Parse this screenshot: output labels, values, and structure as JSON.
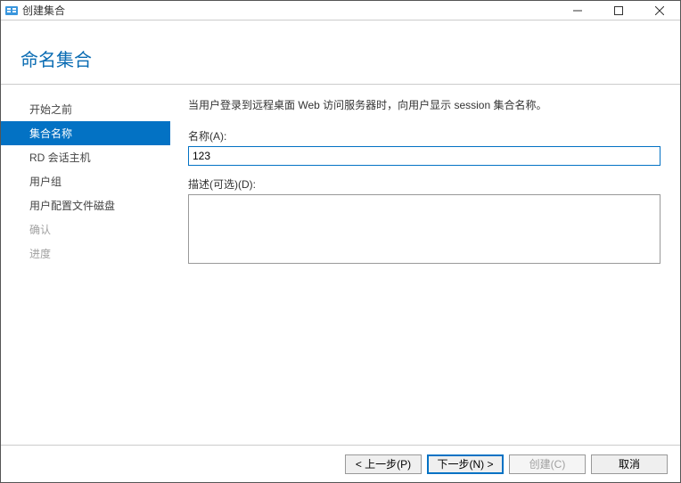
{
  "window": {
    "title": "创建集合"
  },
  "header": {
    "page_title": "命名集合"
  },
  "sidebar": {
    "items": [
      {
        "label": "开始之前",
        "state": "normal"
      },
      {
        "label": "集合名称",
        "state": "active"
      },
      {
        "label": "RD 会话主机",
        "state": "normal"
      },
      {
        "label": "用户组",
        "state": "normal"
      },
      {
        "label": "用户配置文件磁盘",
        "state": "normal"
      },
      {
        "label": "确认",
        "state": "disabled"
      },
      {
        "label": "进度",
        "state": "disabled"
      }
    ]
  },
  "form": {
    "description": "当用户登录到远程桌面 Web 访问服务器时，向用户显示 session 集合名称。",
    "name_label": "名称(A):",
    "name_value": "123",
    "desc_label": "描述(可选)(D):",
    "desc_value": ""
  },
  "footer": {
    "prev": "< 上一步(P)",
    "next": "下一步(N) >",
    "create": "创建(C)",
    "cancel": "取消"
  }
}
